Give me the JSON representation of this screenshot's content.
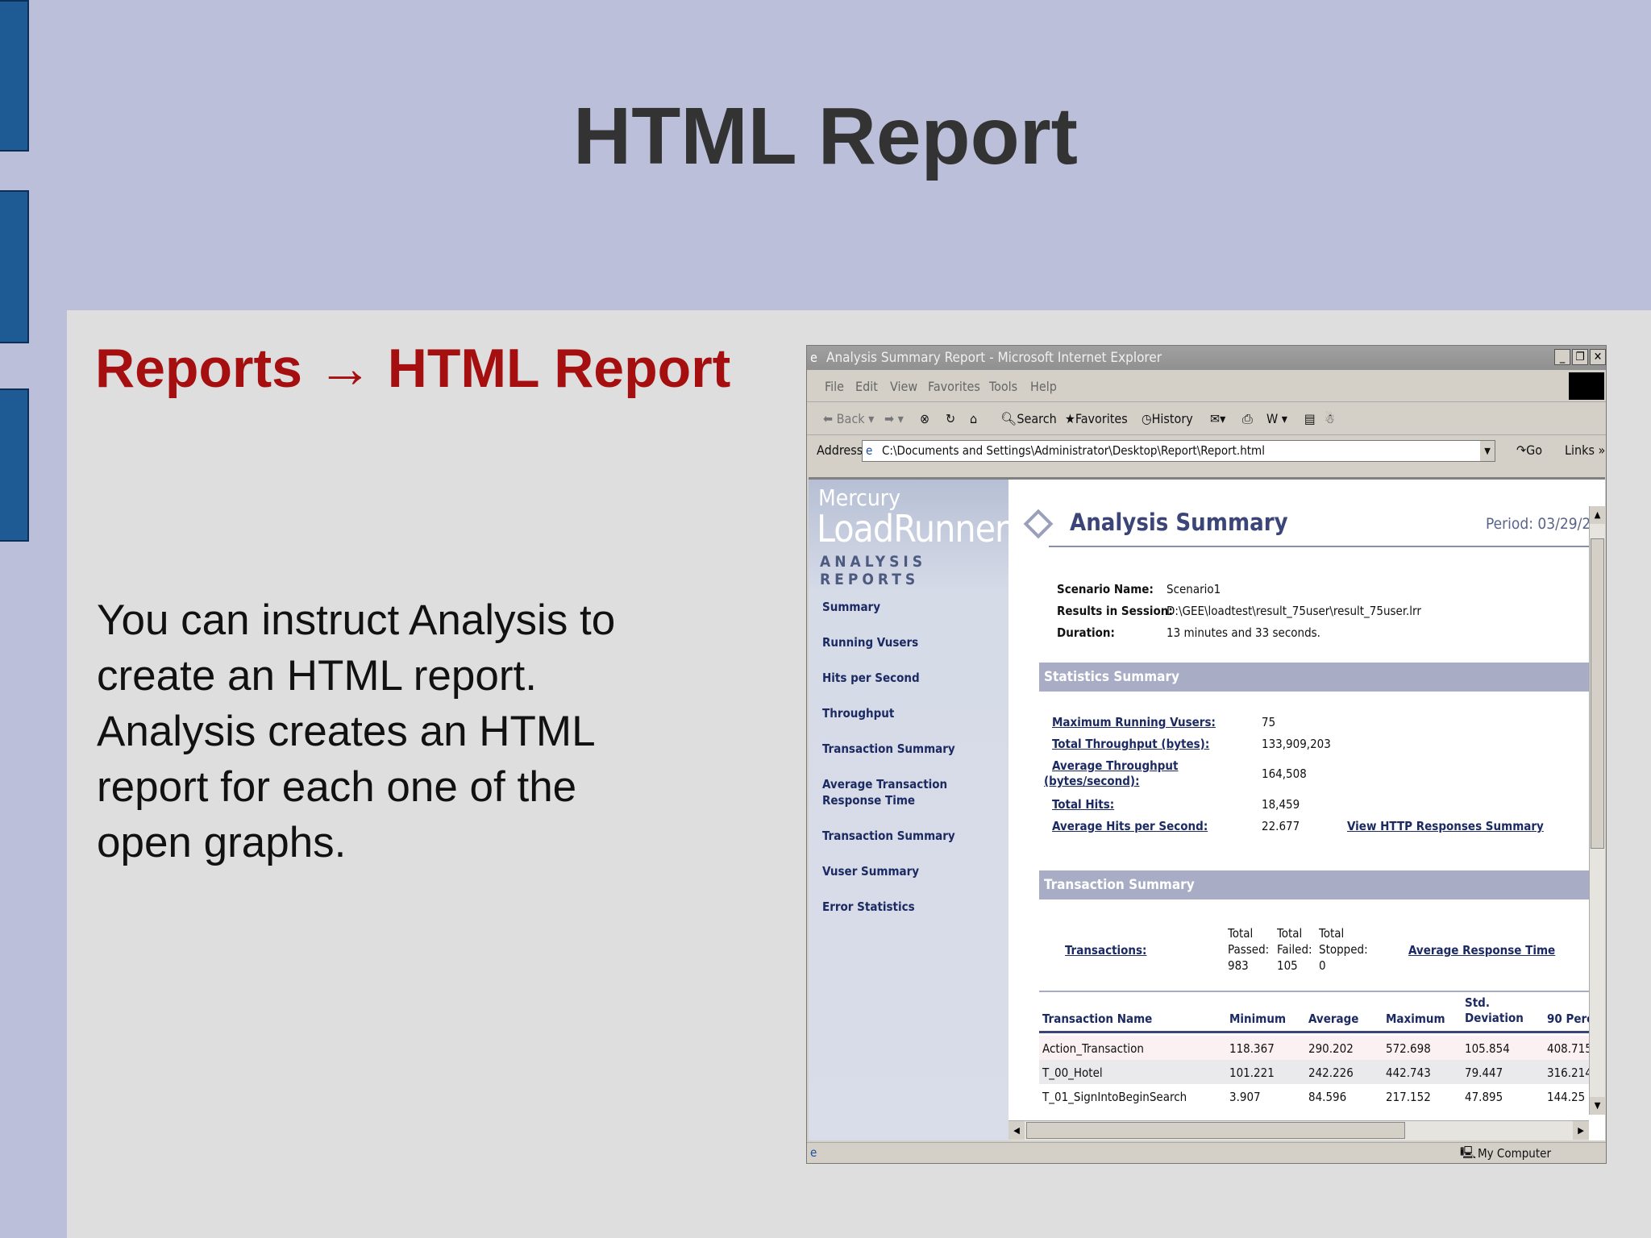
{
  "slide": {
    "title": "HTML Report",
    "subtitle": "Reports → HTML Report",
    "body": "You can instruct Analysis to create an HTML report. Analysis creates an HTML report for each one of the open graphs."
  },
  "browser": {
    "window_title": "Analysis Summary Report - Microsoft Internet Explorer",
    "menu": [
      "File",
      "Edit",
      "View",
      "Favorites",
      "Tools",
      "Help"
    ],
    "toolbar": {
      "back": "Back",
      "search": "Search",
      "favorites": "Favorites",
      "history": "History"
    },
    "address_label": "Address",
    "address": "C:\\Documents and Settings\\Administrator\\Desktop\\Report\\Report.html",
    "go": "Go",
    "links": "Links",
    "status_zone": "My Computer"
  },
  "report": {
    "logo": {
      "line1": "Mercury",
      "line2": "LoadRunner",
      "line3": "ANALYSIS REPORTS"
    },
    "nav": [
      "Summary",
      "Running Vusers",
      "Hits per Second",
      "Throughput",
      "Transaction Summary",
      "Average Transaction Response Time",
      "Transaction Summary",
      "Vuser Summary",
      "Error Statistics"
    ],
    "title": "Analysis Summary",
    "period": "Period: 03/29/2",
    "scenario_label": "Scenario Name:",
    "scenario": "Scenario1",
    "session_label": "Results in Session:",
    "session": "D:\\GEE\\loadtest\\result_75user\\result_75user.lrr",
    "duration_label": "Duration:",
    "duration": "13 minutes and 33 seconds.",
    "stats_header": "Statistics Summary",
    "stats": {
      "max_vusers_label": "Maximum Running Vusers:",
      "max_vusers": "75",
      "throughput_label": "Total Throughput (bytes):",
      "throughput": "133,909,203",
      "avg_throughput_label1": "Average Throughput",
      "avg_throughput_label2": "(bytes/second):",
      "avg_throughput": "164,508",
      "hits_label": "Total Hits:",
      "hits": "18,459",
      "avg_hits_label": "Average Hits per Second:",
      "avg_hits": "22.677",
      "http_link": "View HTTP Responses Summary"
    },
    "trans_header": "Transaction Summary",
    "trans": {
      "label": "Transactions:",
      "passed_h1": "Total",
      "passed_h2": "Passed:",
      "passed": "983",
      "failed_h1": "Total",
      "failed_h2": "Failed:",
      "failed": "105",
      "stopped_h1": "Total",
      "stopped_h2": "Stopped:",
      "stopped": "0",
      "avg_link": "Average Response Time"
    },
    "table": {
      "headers": [
        "Transaction Name",
        "Minimum",
        "Average",
        "Maximum",
        "Std.",
        "Deviation",
        "90 Perc"
      ],
      "rows": [
        [
          "Action_Transaction",
          "118.367",
          "290.202",
          "572.698",
          "105.854",
          "408.715"
        ],
        [
          "T_00_Hotel",
          "101.221",
          "242.226",
          "442.743",
          "79.447",
          "316.214"
        ],
        [
          "T_01_SignIntoBeginSearch",
          "3.907",
          "84.596",
          "217.152",
          "47.895",
          "144.25"
        ]
      ]
    }
  }
}
